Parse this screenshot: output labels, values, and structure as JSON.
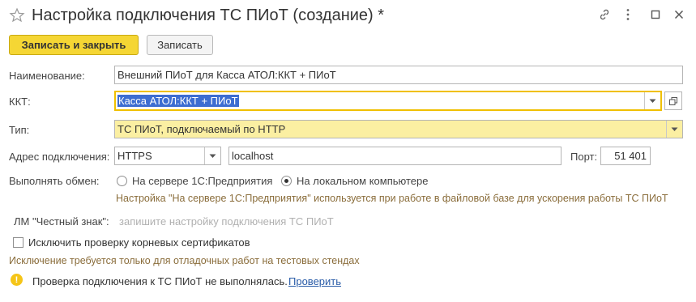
{
  "window": {
    "title": "Настройка подключения ТС ПИоТ (создание) *"
  },
  "toolbar": {
    "save_close_label": "Записать и закрыть",
    "save_label": "Записать"
  },
  "form": {
    "name_label": "Наименование:",
    "name_value": "Внешний ПИоТ для Касса АТОЛ:ККТ + ПИоТ",
    "kkt_label": "ККТ:",
    "kkt_value": "Касса АТОЛ:ККТ + ПИоТ",
    "type_label": "Тип:",
    "type_value": "ТС ПИоТ, подключаемый по HTTP",
    "address_label": "Адрес подключения:",
    "protocol_value": "HTTPS",
    "host_value": "localhost",
    "port_label": "Порт:",
    "port_value": "51 401",
    "exchange_label": "Выполнять обмен:",
    "radio_server_label": "На сервере 1С:Предприятия",
    "radio_local_label": "На локальном компьютере",
    "exchange_hint": "Настройка \"На сервере 1С:Предприятия\" используется при работе в файловой базе для ускорения работы ТС ПИоТ",
    "lm_label": "ЛМ \"Честный знак\":",
    "lm_placeholder": "запишите настройку подключения ТС ПИоТ",
    "exclude_cert_label": "Исключить проверку корневых сертификатов",
    "exclude_hint": "Исключение требуется только для отладочных работ на тестовых стендах",
    "status_text": "Проверка подключения к ТС ПИоТ не выполнялась.",
    "check_link": "Проверить"
  },
  "colors": {
    "primary_button": "#f5d634",
    "focus_border": "#f0c000",
    "selection": "#3d6dd1",
    "hint_text": "#8a6d3b",
    "link": "#2a5ca8",
    "warning": "#f5c518"
  }
}
